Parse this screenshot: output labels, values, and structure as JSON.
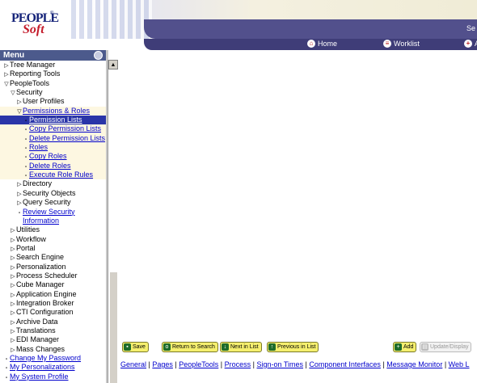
{
  "header": {
    "logo_top": "PEOPLE",
    "logo_bottom": "Soft",
    "logo_tm": "®",
    "bar_text": "Se",
    "nav": [
      {
        "label": "Home",
        "icon": "house-icon"
      },
      {
        "label": "Worklist",
        "icon": "worklist-icon"
      },
      {
        "label": "A",
        "icon": "addto-icon"
      }
    ]
  },
  "menu": {
    "title": "Menu",
    "items": [
      {
        "label": "Tree Manager",
        "indent": 0,
        "kind": "closed"
      },
      {
        "label": "Reporting Tools",
        "indent": 0,
        "kind": "closed"
      },
      {
        "label": "PeopleTools",
        "indent": 0,
        "kind": "open"
      },
      {
        "label": "Security",
        "indent": 1,
        "kind": "open"
      },
      {
        "label": "User Profiles",
        "indent": 2,
        "kind": "closed"
      },
      {
        "label": "Permissions & Roles",
        "indent": 2,
        "kind": "open-link",
        "hl": true
      },
      {
        "label": "Permission Lists",
        "indent": 3,
        "kind": "dash",
        "hl": true,
        "selected": true
      },
      {
        "label": "Copy Permission Lists",
        "indent": 3,
        "kind": "dash",
        "hl": true
      },
      {
        "label": "Delete Permission Lists",
        "indent": 3,
        "kind": "dash",
        "hl": true
      },
      {
        "label": "Roles",
        "indent": 3,
        "kind": "dash",
        "hl": true
      },
      {
        "label": "Copy Roles",
        "indent": 3,
        "kind": "dash",
        "hl": true
      },
      {
        "label": "Delete Roles",
        "indent": 3,
        "kind": "dash",
        "hl": true
      },
      {
        "label": "Execute Role Rules",
        "indent": 3,
        "kind": "dash",
        "hl": true
      },
      {
        "label": "Directory",
        "indent": 2,
        "kind": "closed"
      },
      {
        "label": "Security Objects",
        "indent": 2,
        "kind": "closed"
      },
      {
        "label": "Query Security",
        "indent": 2,
        "kind": "closed"
      },
      {
        "label": "Review Security",
        "indent": 2,
        "kind": "dash"
      },
      {
        "label": "Information",
        "indent": 2,
        "kind": "cont"
      },
      {
        "label": "Utilities",
        "indent": 1,
        "kind": "closed"
      },
      {
        "label": "Workflow",
        "indent": 1,
        "kind": "closed"
      },
      {
        "label": "Portal",
        "indent": 1,
        "kind": "closed"
      },
      {
        "label": "Search Engine",
        "indent": 1,
        "kind": "closed"
      },
      {
        "label": "Personalization",
        "indent": 1,
        "kind": "closed"
      },
      {
        "label": "Process Scheduler",
        "indent": 1,
        "kind": "closed"
      },
      {
        "label": "Cube Manager",
        "indent": 1,
        "kind": "closed"
      },
      {
        "label": "Application Engine",
        "indent": 1,
        "kind": "closed"
      },
      {
        "label": "Integration Broker",
        "indent": 1,
        "kind": "closed"
      },
      {
        "label": "CTI Configuration",
        "indent": 1,
        "kind": "closed"
      },
      {
        "label": "Archive Data",
        "indent": 1,
        "kind": "closed"
      },
      {
        "label": "Translations",
        "indent": 1,
        "kind": "closed"
      },
      {
        "label": "EDI Manager",
        "indent": 1,
        "kind": "closed"
      },
      {
        "label": "Mass Changes",
        "indent": 1,
        "kind": "closed"
      },
      {
        "label": "Change My Password",
        "indent": 0,
        "kind": "dash"
      },
      {
        "label": "My Personalizations",
        "indent": 0,
        "kind": "dash"
      },
      {
        "label": "My System Profile",
        "indent": 0,
        "kind": "dash"
      }
    ]
  },
  "toolbar": {
    "save": "Save",
    "return_to_search": "Return to Search",
    "next_in_list": "Next in List",
    "previous_in_list": "Previous in List",
    "add": "Add",
    "update_display": "Update/Display"
  },
  "page_links": [
    "General",
    "Pages",
    "PeopleTools",
    "Process",
    "Sign-on Times",
    "Component Interfaces",
    "Message Monitor",
    "Web L"
  ],
  "colors": {
    "menu_header": "#4c5a8c",
    "bar": "#52508c",
    "selected": "#2a35a8",
    "link": "#0000cc",
    "button": "#f5ef6e"
  }
}
